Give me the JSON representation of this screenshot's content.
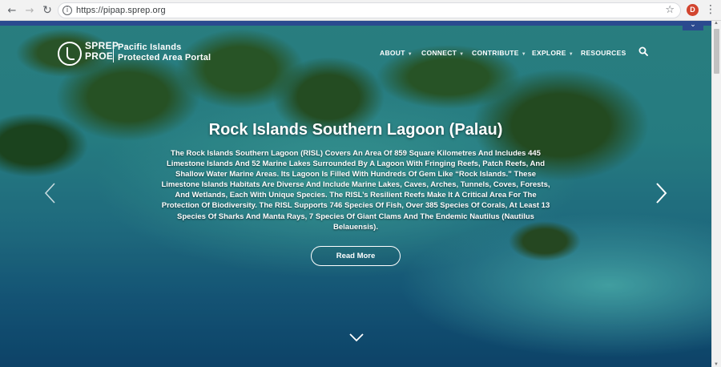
{
  "browser": {
    "url": "https://pipap.sprep.org",
    "profile_initial": "D"
  },
  "site": {
    "logo_line1": "SPREP",
    "logo_line2": "PROE",
    "title_line1": "Pacific Islands",
    "title_line2": "Protected Area Portal"
  },
  "nav": {
    "items": [
      {
        "label": "ABOUT",
        "has_dropdown": true
      },
      {
        "label": "CONNECT",
        "has_dropdown": true
      },
      {
        "label": "CONTRIBUTE",
        "has_dropdown": true
      },
      {
        "label": "EXPLORE",
        "has_dropdown": true
      },
      {
        "label": "RESOURCES",
        "has_dropdown": false
      }
    ],
    "search_icon": "search-icon"
  },
  "slide": {
    "title": "Rock Islands Southern Lagoon (Palau)",
    "description": "The Rock Islands Southern Lagoon (RISL) Covers An Area Of 859 Square Kilometres And Includes 445 Limestone Islands And 52 Marine Lakes Surrounded By A Lagoon With Fringing Reefs, Patch Reefs, And Shallow Water Marine Areas. Its Lagoon Is Filled With Hundreds Of Gem Like “Rock Islands.” These Limestone Islands Habitats Are Diverse And Include Marine Lakes, Caves, Arches, Tunnels, Coves, Forests, And Wetlands, Each With Unique Species. The RISL’s Resilient Reefs Make It A Critical Area For The Protection Of Biodiversity. The RISL Supports 746 Species Of Fish, Over 385 Species Of Corals, At Least 13 Species Of Sharks And Manta Rays, 7 Species Of Giant Clams And The Endemic Nautilus (Nautilus Belauensis).",
    "button_label": "Read More"
  },
  "colors": {
    "accent_bar": "#2b4a8f",
    "profile_badge": "#d2452f"
  }
}
